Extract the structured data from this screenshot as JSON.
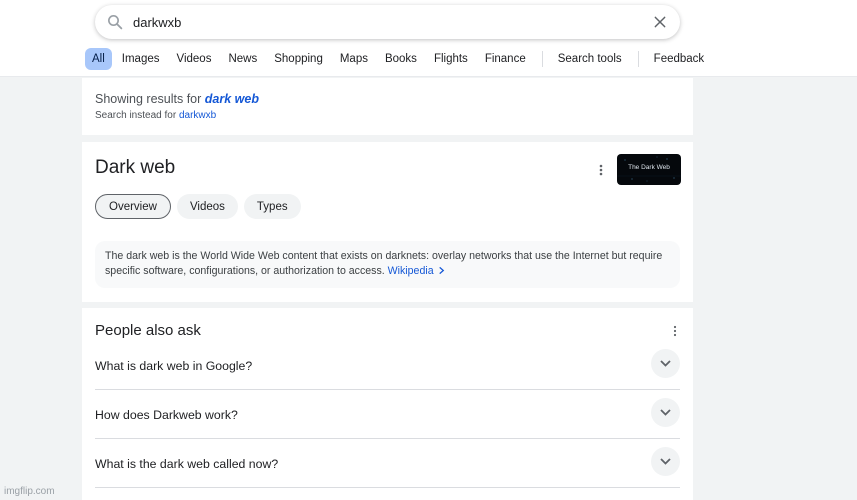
{
  "search": {
    "query": "darkwxb"
  },
  "tabs": [
    {
      "label": "All",
      "active": true
    },
    {
      "label": "Images"
    },
    {
      "label": "Videos"
    },
    {
      "label": "News"
    },
    {
      "label": "Shopping"
    },
    {
      "label": "Maps"
    },
    {
      "label": "Books"
    },
    {
      "label": "Flights"
    },
    {
      "label": "Finance"
    }
  ],
  "tools": {
    "search_tools": "Search tools",
    "feedback": "Feedback"
  },
  "spelling": {
    "showing_prefix": "Showing results for",
    "corrected": "dark web",
    "instead_prefix": "Search instead for",
    "original": "darkwxb"
  },
  "knowledge_panel": {
    "title": "Dark web",
    "thumbnail_label": "The Dark Web",
    "chips": [
      {
        "label": "Overview",
        "active": true
      },
      {
        "label": "Videos"
      },
      {
        "label": "Types"
      }
    ],
    "description": "The dark web is the World Wide Web content that exists on darknets: overlay networks that use the Internet but require specific software, configurations, or authorization to access.",
    "source_link": "Wikipedia"
  },
  "people_also_ask": {
    "title": "People also ask",
    "questions": [
      "What is dark web in Google?",
      "How does Darkweb work?",
      "What is the dark web called now?"
    ]
  },
  "watermark": "imgflip.com",
  "colors": {
    "accent_blue": "#1558d6",
    "active_tab_bg": "#a8c7fa",
    "page_bg": "#f1f3f4"
  }
}
